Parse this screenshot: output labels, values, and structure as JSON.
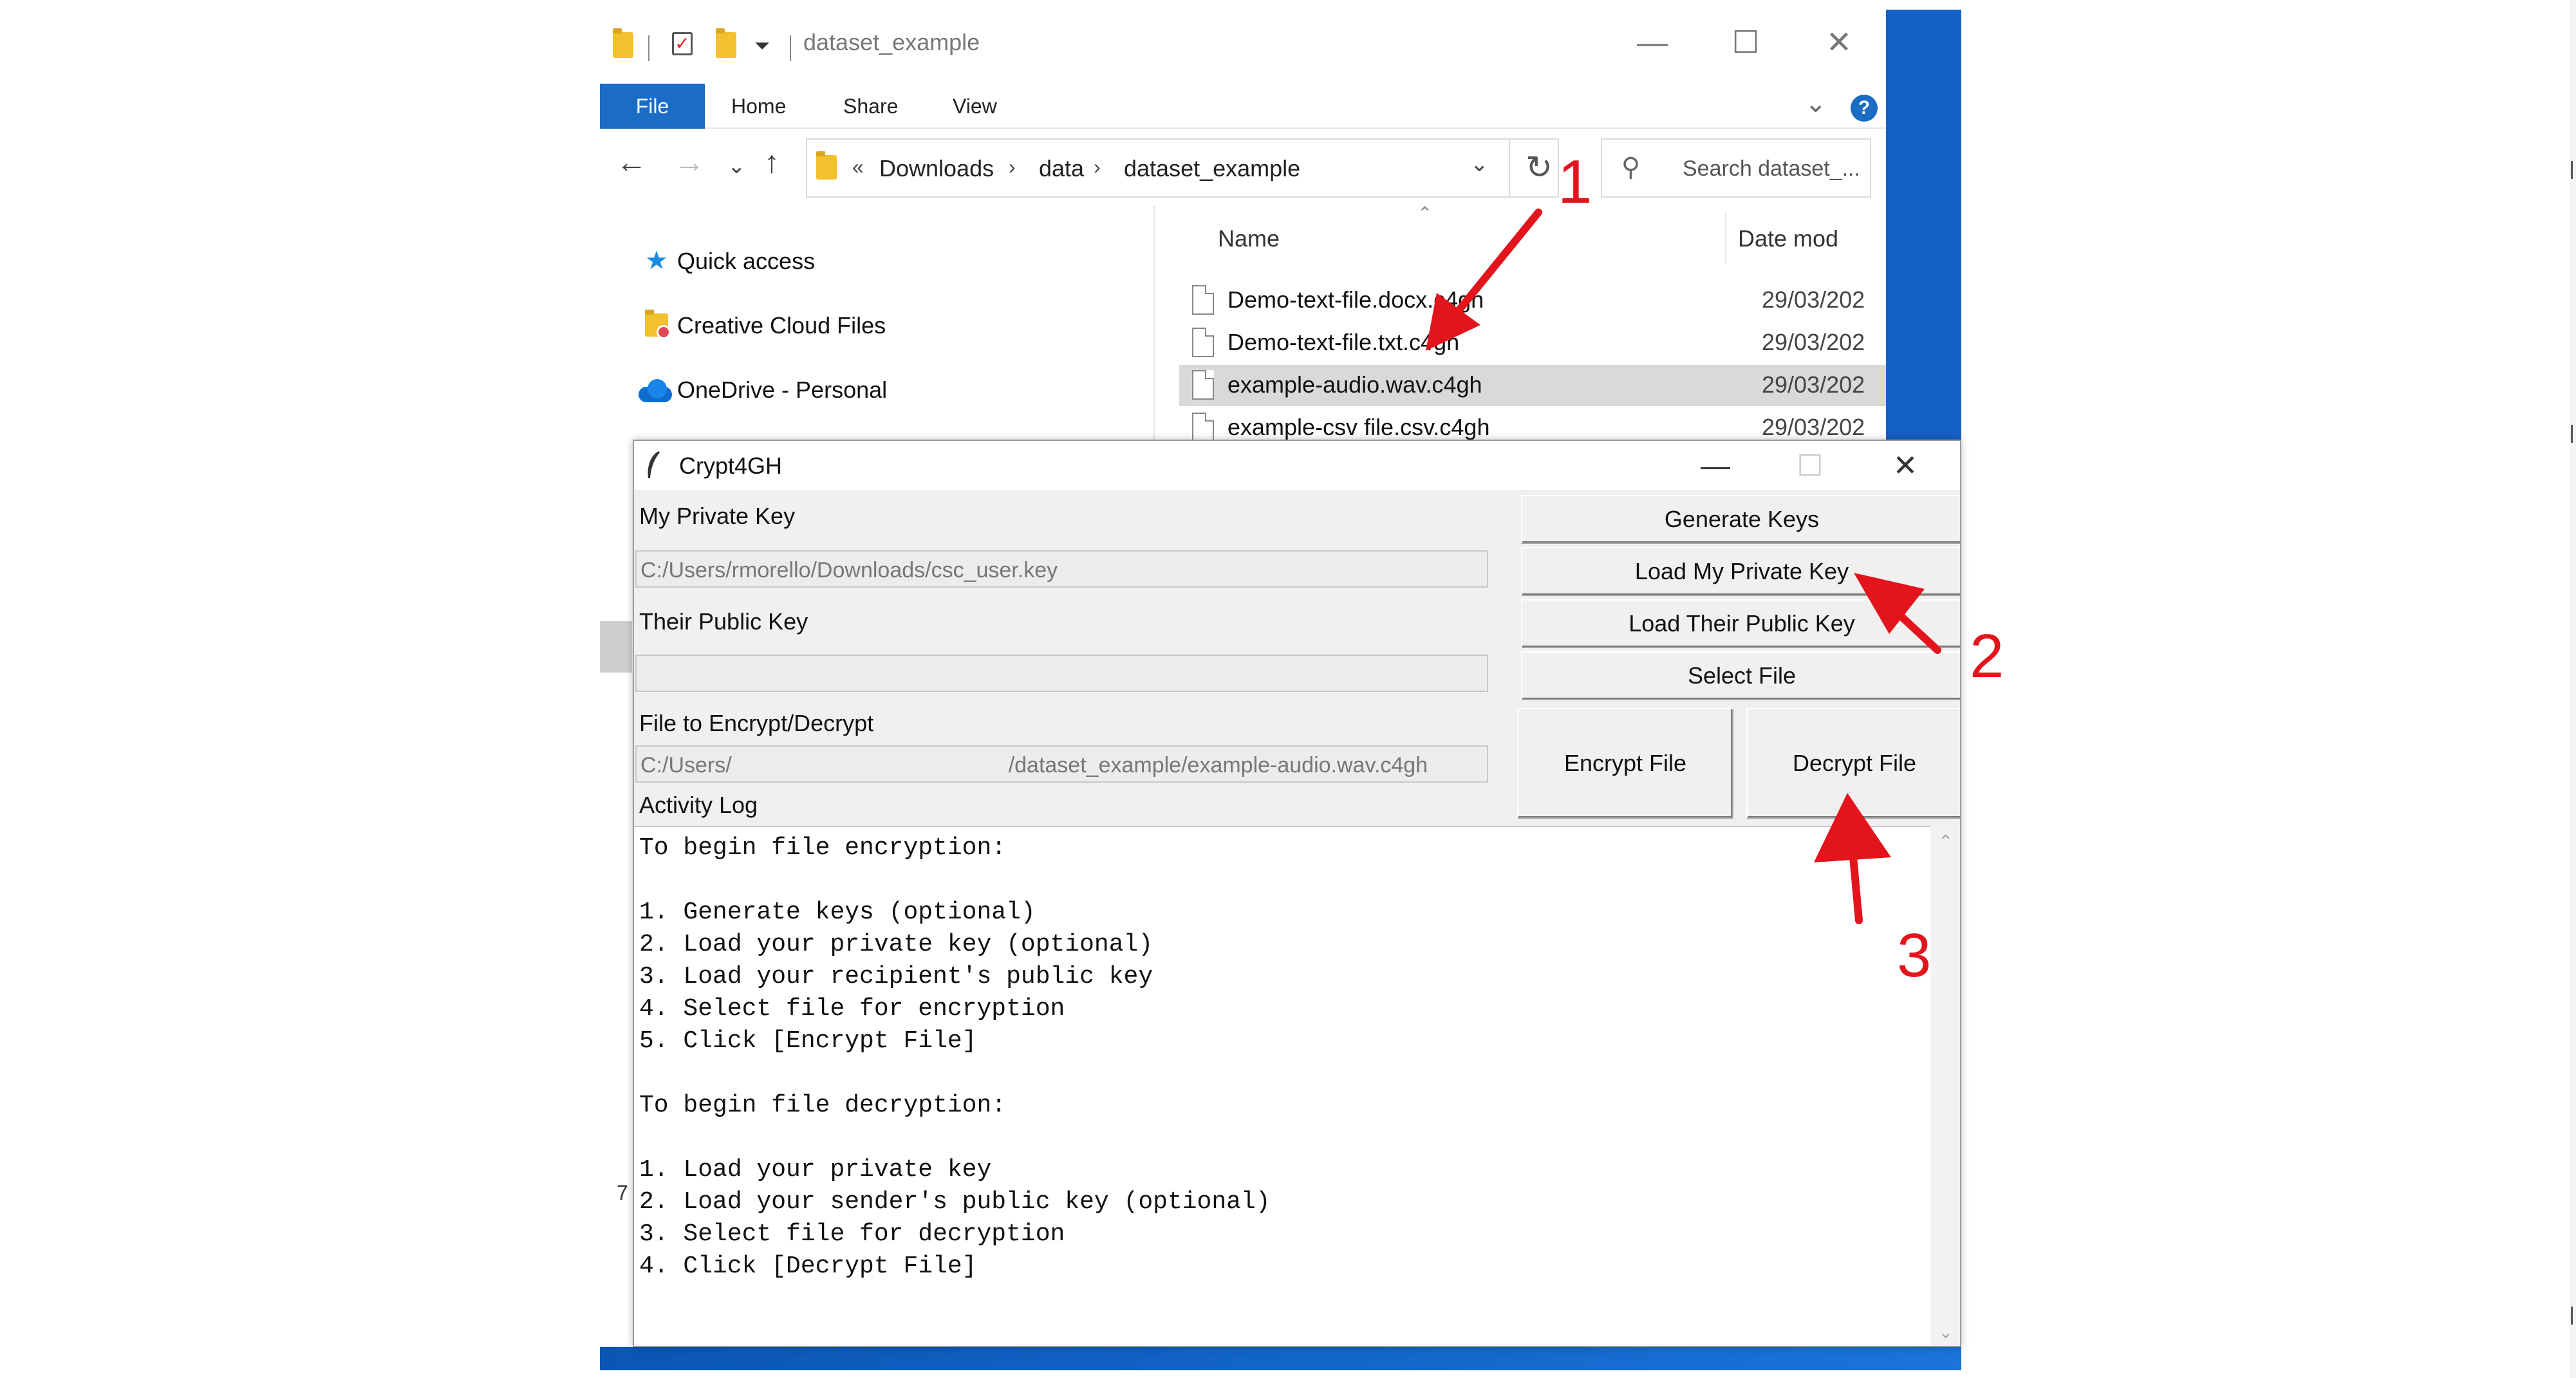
{
  "explorer": {
    "title": "dataset_example",
    "window_controls": {
      "minimize": "—",
      "maximize": "☐",
      "close": "✕"
    },
    "ribbon": {
      "file": "File",
      "home": "Home",
      "share": "Share",
      "view": "View",
      "help": "?"
    },
    "breadcrumb": {
      "overflow": "«",
      "items": [
        "Downloads",
        "data",
        "dataset_example"
      ]
    },
    "search_placeholder": "Search dataset_...",
    "nav_pane": [
      {
        "label": "Quick access",
        "icon": "star-icon"
      },
      {
        "label": "Creative Cloud Files",
        "icon": "creative-cloud-folder-icon"
      },
      {
        "label": "OneDrive - Personal",
        "icon": "onedrive-cloud-icon"
      }
    ],
    "columns": {
      "name": "Name",
      "date": "Date mod"
    },
    "files": [
      {
        "name": "Demo-text-file.docx.c4gh",
        "date": "29/03/202",
        "selected": false
      },
      {
        "name": "Demo-text-file.txt.c4gh",
        "date": "29/03/202",
        "selected": false
      },
      {
        "name": "example-audio.wav.c4gh",
        "date": "29/03/202",
        "selected": true
      },
      {
        "name": "example-csv file.csv.c4gh",
        "date": "29/03/202",
        "selected": false
      }
    ],
    "status_count": "7"
  },
  "crypt4gh": {
    "title": "Crypt4GH",
    "window_controls": {
      "minimize": "—",
      "maximize": "☐",
      "close": "✕"
    },
    "labels": {
      "private_key": "My Private Key",
      "public_key": "Their Public Key",
      "file": "File to Encrypt/Decrypt",
      "activity_log": "Activity Log"
    },
    "fields": {
      "private_key": "C:/Users/rmorello/Downloads/csc_user.key",
      "public_key": "",
      "file_prefix": "C:/Users/",
      "file_suffix": "/dataset_example/example-audio.wav.c4gh"
    },
    "buttons": {
      "generate_keys": "Generate Keys",
      "load_private": "Load My Private Key",
      "load_public": "Load Their Public Key",
      "select_file": "Select File",
      "encrypt": "Encrypt File",
      "decrypt": "Decrypt File"
    },
    "log_lines": [
      "To begin file encryption:",
      "",
      "1. Generate keys (optional)",
      "2. Load your private key (optional)",
      "3. Load your recipient's public key",
      "4. Select file for encryption",
      "5. Click [Encrypt File]",
      "",
      "To begin file decryption:",
      "",
      "1. Load your private key",
      "2. Load your sender's public key (optional)",
      "3. Select file for decryption",
      "4. Click [Decrypt File]"
    ]
  },
  "annotations": [
    {
      "number": "1"
    },
    {
      "number": "2"
    },
    {
      "number": "3"
    }
  ],
  "colors": {
    "accent": "#1a6cc4",
    "annotation": "#e3141c",
    "selection": "#d9d9d9"
  }
}
